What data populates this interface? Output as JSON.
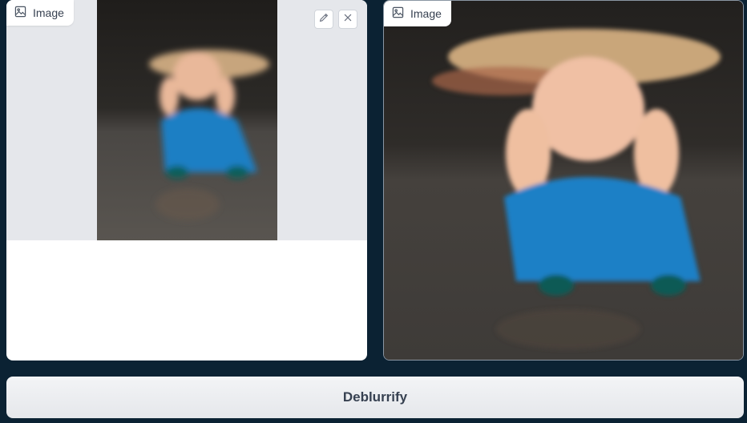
{
  "input_image": {
    "label": "Image",
    "icon": "image-icon",
    "tools": [
      "pencil-icon",
      "close-icon"
    ]
  },
  "output_image": {
    "label": "Image",
    "icon": "image-icon"
  },
  "actions": {
    "submit_label": "Deblurrify"
  }
}
